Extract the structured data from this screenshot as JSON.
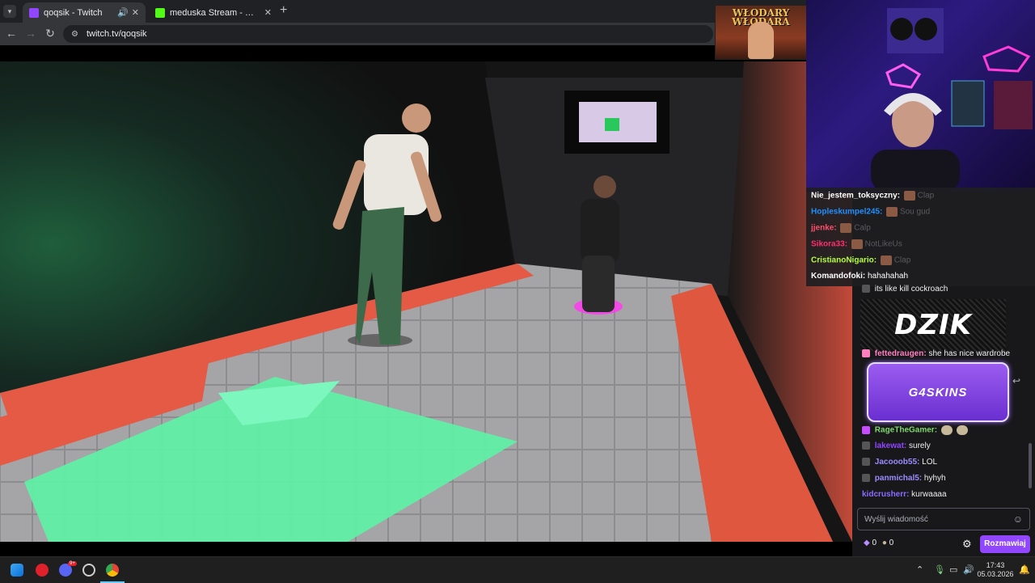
{
  "browser": {
    "tabs": [
      {
        "title": "qoqsik - Twitch",
        "favicon_color": "#9146ff"
      },
      {
        "title": "meduska Stream - Watch Live on Kick",
        "favicon_color": "#53fc18"
      }
    ],
    "new_tab_icon": "plus-icon",
    "url": "twitch.tv/qoqsik"
  },
  "overlay": {
    "title_line1": "WŁODARY",
    "title_line2": "WŁODARA"
  },
  "overlay_chat": [
    {
      "user": "Nie_jestem_toksyczny:",
      "color": "#ffffff",
      "message": "",
      "ghost": "Clap"
    },
    {
      "user": "Hopleskumpel245:",
      "color": "#1e90ff",
      "message": "",
      "ghost": "Sou gud"
    },
    {
      "user": "jjenke:",
      "color": "#ff4d6a",
      "message": "",
      "ghost": "Calp"
    },
    {
      "user": "Sikora33:",
      "color": "#ff2e6e",
      "message": "",
      "ghost": "NotLikeUs"
    },
    {
      "user": "CristianoNigario:",
      "color": "#b6ff3a",
      "message": "",
      "ghost": "Clap"
    },
    {
      "user": "Komandofoki:",
      "color": "#ffffff",
      "message": "hahahahah",
      "ghost": ""
    }
  ],
  "chat": {
    "top_partial": "its like kill cockroach",
    "banner1": "DZIK",
    "messages": [
      {
        "user": "fettedraugen:",
        "color": "#ff7fbf",
        "message": "she has nice wardrobe"
      }
    ],
    "banner2": "G4SKINS",
    "messages2": [
      {
        "user": "RageTheGamer:",
        "color": "#7fd66a",
        "message": ""
      },
      {
        "user": "lakewat:",
        "color": "#9146ff",
        "message": "surely"
      },
      {
        "user": "Jacooob55:",
        "color": "#9b8cff",
        "message": "LOL"
      },
      {
        "user": "panmichal5:",
        "color": "#9b8cff",
        "message": "hyhyh"
      },
      {
        "user": "kidcrusherr:",
        "color": "#8a6cff",
        "message": "kurwaaaa"
      }
    ],
    "input_placeholder": "Wyślij wiadomość",
    "points_a": "0",
    "points_b": "0",
    "send_label": "Rozmawiaj"
  },
  "taskbar": {
    "time": "17:43",
    "date": "05.03.2026",
    "discord_badge": "9+"
  }
}
